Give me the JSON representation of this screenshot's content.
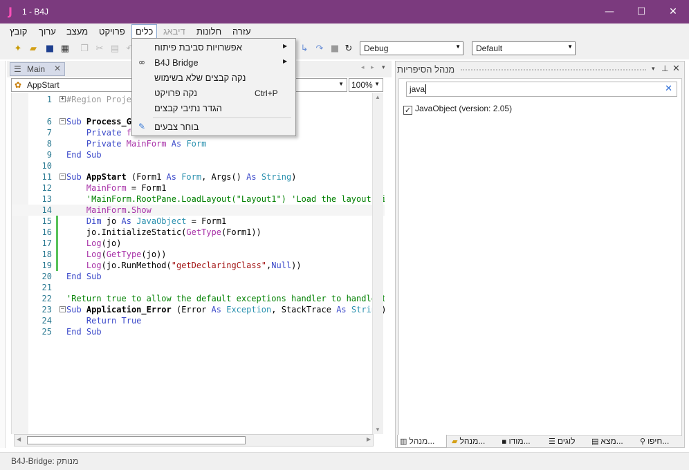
{
  "window": {
    "title": "1 - B4J",
    "logo": "J",
    "minimize": "—",
    "maximize": "☐",
    "close": "✕"
  },
  "menubar": {
    "file": "קובץ",
    "edit": "ערוך",
    "designer": "מעצב",
    "project": "פרויקט",
    "tools": "כלים",
    "debug": "דיבאג",
    "windows": "חלונות",
    "help": "עזרה"
  },
  "toolbar": {
    "build_config": "Debug",
    "package": "Default"
  },
  "editor": {
    "tab_label": "Main",
    "sub_selector": "AppStart",
    "zoom": "100%",
    "lines": [
      {
        "n": "1",
        "html": "<span style='color:#999'>#Region Project Attributes</span>",
        "fold": "+"
      },
      {
        "n": "6",
        "html": "<span class='kw'>Sub</span> <span class='bold'>Process_Globals</span>",
        "fold": "−"
      },
      {
        "n": "7",
        "html": "    <span class='kw'>Private</span> <span class='fn'>fx</span> <span class='kw'>As</span> <span class='ty'>JFX</span>"
      },
      {
        "n": "8",
        "html": "    <span class='kw'>Private</span> <span class='fn'>MainForm</span> <span class='kw'>As</span> <span class='ty'>Form</span>"
      },
      {
        "n": "9",
        "html": "<span class='kw'>End Sub</span>"
      },
      {
        "n": "10",
        "html": ""
      },
      {
        "n": "11",
        "html": "<span class='kw'>Sub</span> <span class='bold'>AppStart</span> (Form1 <span class='kw'>As</span> <span class='ty'>Form</span>, Args() <span class='kw'>As</span> <span class='ty'>String</span>)",
        "fold": "−"
      },
      {
        "n": "12",
        "html": "    <span class='fn'>MainForm</span> = Form1"
      },
      {
        "n": "13",
        "html": "    <span class='cm'>'MainForm.RootPane.LoadLayout(\"Layout1\") 'Load the layout file.</span>"
      },
      {
        "n": "14",
        "html": "    <span class='fn'>MainForm</span>.<span class='fn'>Show</span>",
        "hl": true
      },
      {
        "n": "15",
        "html": "    <span class='kw'>Dim</span> jo <span class='kw'>As</span> <span class='ty'>JavaObject</span> = Form1",
        "chg": true
      },
      {
        "n": "16",
        "html": "    jo.InitializeStatic(<span class='fn'>GetType</span>(Form1))",
        "chg": true
      },
      {
        "n": "17",
        "html": "    <span class='fn'>Log</span>(jo)",
        "chg": true
      },
      {
        "n": "18",
        "html": "    <span class='fn'>Log</span>(<span class='fn'>GetType</span>(jo))",
        "chg": true
      },
      {
        "n": "19",
        "html": "    <span class='fn'>Log</span>(jo.RunMethod(<span class='st'>\"getDeclaringClass\"</span>,<span class='kw'>Null</span>))",
        "chg": true
      },
      {
        "n": "20",
        "html": "<span class='kw'>End Sub</span>"
      },
      {
        "n": "21",
        "html": ""
      },
      {
        "n": "22",
        "html": "<span class='cm'>'Return true to allow the default exceptions handler to handle the uncaught exception.</span>"
      },
      {
        "n": "23",
        "html": "<span class='kw'>Sub</span> <span class='bold'>Application_Error</span> (Error <span class='kw'>As</span> <span class='ty'>Exception</span>, StackTrace <span class='kw'>As</span> <span class='ty'>String</span>) <span class='kw'>As</span> <span class='ty'>Boolean</span>",
        "fold": "−"
      },
      {
        "n": "24",
        "html": "    <span class='kw'>Return</span> <span class='kw'>True</span>"
      },
      {
        "n": "25",
        "html": "<span class='kw'>End Sub</span>"
      }
    ]
  },
  "tools_menu": {
    "items": [
      {
        "label": "אפשרויות סביבת פיתוח",
        "submenu": "▶"
      },
      {
        "label": "B4J Bridge",
        "submenu": "▶",
        "icon": "∞"
      },
      {
        "label": "נקה קבצים שלא בשימוש"
      },
      {
        "label": "נקה פרויקט",
        "shortcut": "Ctrl+P"
      },
      {
        "label": "הגדר נתיבי קבצים"
      },
      {
        "label": "בוחר צבעים",
        "icon": "✎"
      }
    ]
  },
  "libraries_panel": {
    "title": "מנהל הסיפריות",
    "search_value": "java",
    "clear": "✕",
    "items": [
      {
        "label": "JavaObject (version: 2.05)",
        "checked": "✓"
      }
    ],
    "tabs": {
      "libs": "מנהל...",
      "files": "מנהל...",
      "modules": "מודו...",
      "logs": "לוגים",
      "find": "מצא...",
      "search": "חיפו..."
    }
  },
  "statusbar": {
    "text": "B4J-Bridge: מנותק"
  }
}
